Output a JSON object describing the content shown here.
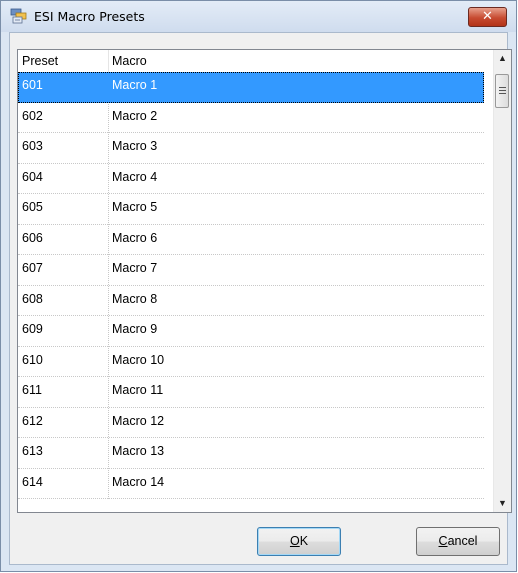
{
  "window": {
    "title": "ESI Macro Presets",
    "close_glyph": "✕",
    "icon": "macro-presets-icon"
  },
  "list": {
    "columns": [
      "Preset",
      "Macro"
    ],
    "rows": [
      {
        "preset": "601",
        "macro": "Macro 1",
        "selected": true
      },
      {
        "preset": "602",
        "macro": "Macro 2"
      },
      {
        "preset": "603",
        "macro": "Macro 3"
      },
      {
        "preset": "604",
        "macro": "Macro 4"
      },
      {
        "preset": "605",
        "macro": "Macro 5"
      },
      {
        "preset": "606",
        "macro": "Macro 6"
      },
      {
        "preset": "607",
        "macro": "Macro 7"
      },
      {
        "preset": "608",
        "macro": "Macro 8"
      },
      {
        "preset": "609",
        "macro": "Macro 9"
      },
      {
        "preset": "610",
        "macro": "Macro 10"
      },
      {
        "preset": "611",
        "macro": "Macro 11"
      },
      {
        "preset": "612",
        "macro": "Macro 12"
      },
      {
        "preset": "613",
        "macro": "Macro 13"
      },
      {
        "preset": "614",
        "macro": "Macro 14"
      }
    ]
  },
  "buttons": {
    "ok": {
      "label": "OK",
      "accel": "O"
    },
    "cancel": {
      "label": "Cancel",
      "accel": "C"
    }
  },
  "colors": {
    "selection": "#3399ff",
    "close_button": "#c74b31"
  }
}
